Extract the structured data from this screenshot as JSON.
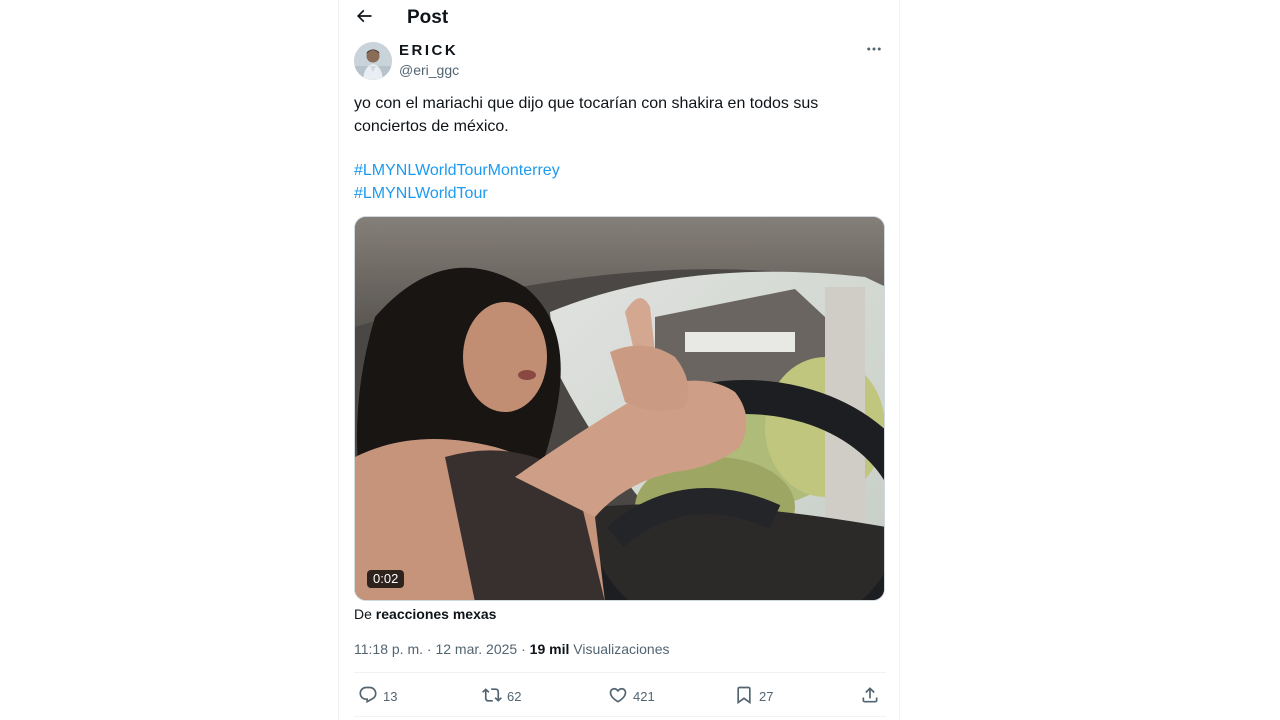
{
  "header": {
    "title": "Post",
    "back_icon": "arrow-left-icon"
  },
  "author": {
    "display_name": "ERICK",
    "handle": "@eri_ggc",
    "more_icon": "more-horizontal-icon"
  },
  "tweet": {
    "text_line1": "yo con el mariachi que dijo que tocarían con shakira en todos sus",
    "text_line2": "conciertos de méxico.",
    "hashtags": [
      "#LMYNLWorldTourMonterrey",
      "#LMYNLWorldTour"
    ]
  },
  "media": {
    "type": "video",
    "duration": "0:02"
  },
  "source": {
    "prefix": "De ",
    "name": "reacciones mexas"
  },
  "meta": {
    "time": "11:18 p. m.",
    "separator1": " · ",
    "date": "12 mar. 2025",
    "separator2": " · ",
    "views_count": "19 mil",
    "views_label": " Visualizaciones"
  },
  "actions": {
    "replies": "13",
    "reposts": "62",
    "likes": "421",
    "bookmarks": "27"
  },
  "colors": {
    "link": "#1d9bf0",
    "secondary_text": "#536471",
    "border": "#eff3f4"
  }
}
